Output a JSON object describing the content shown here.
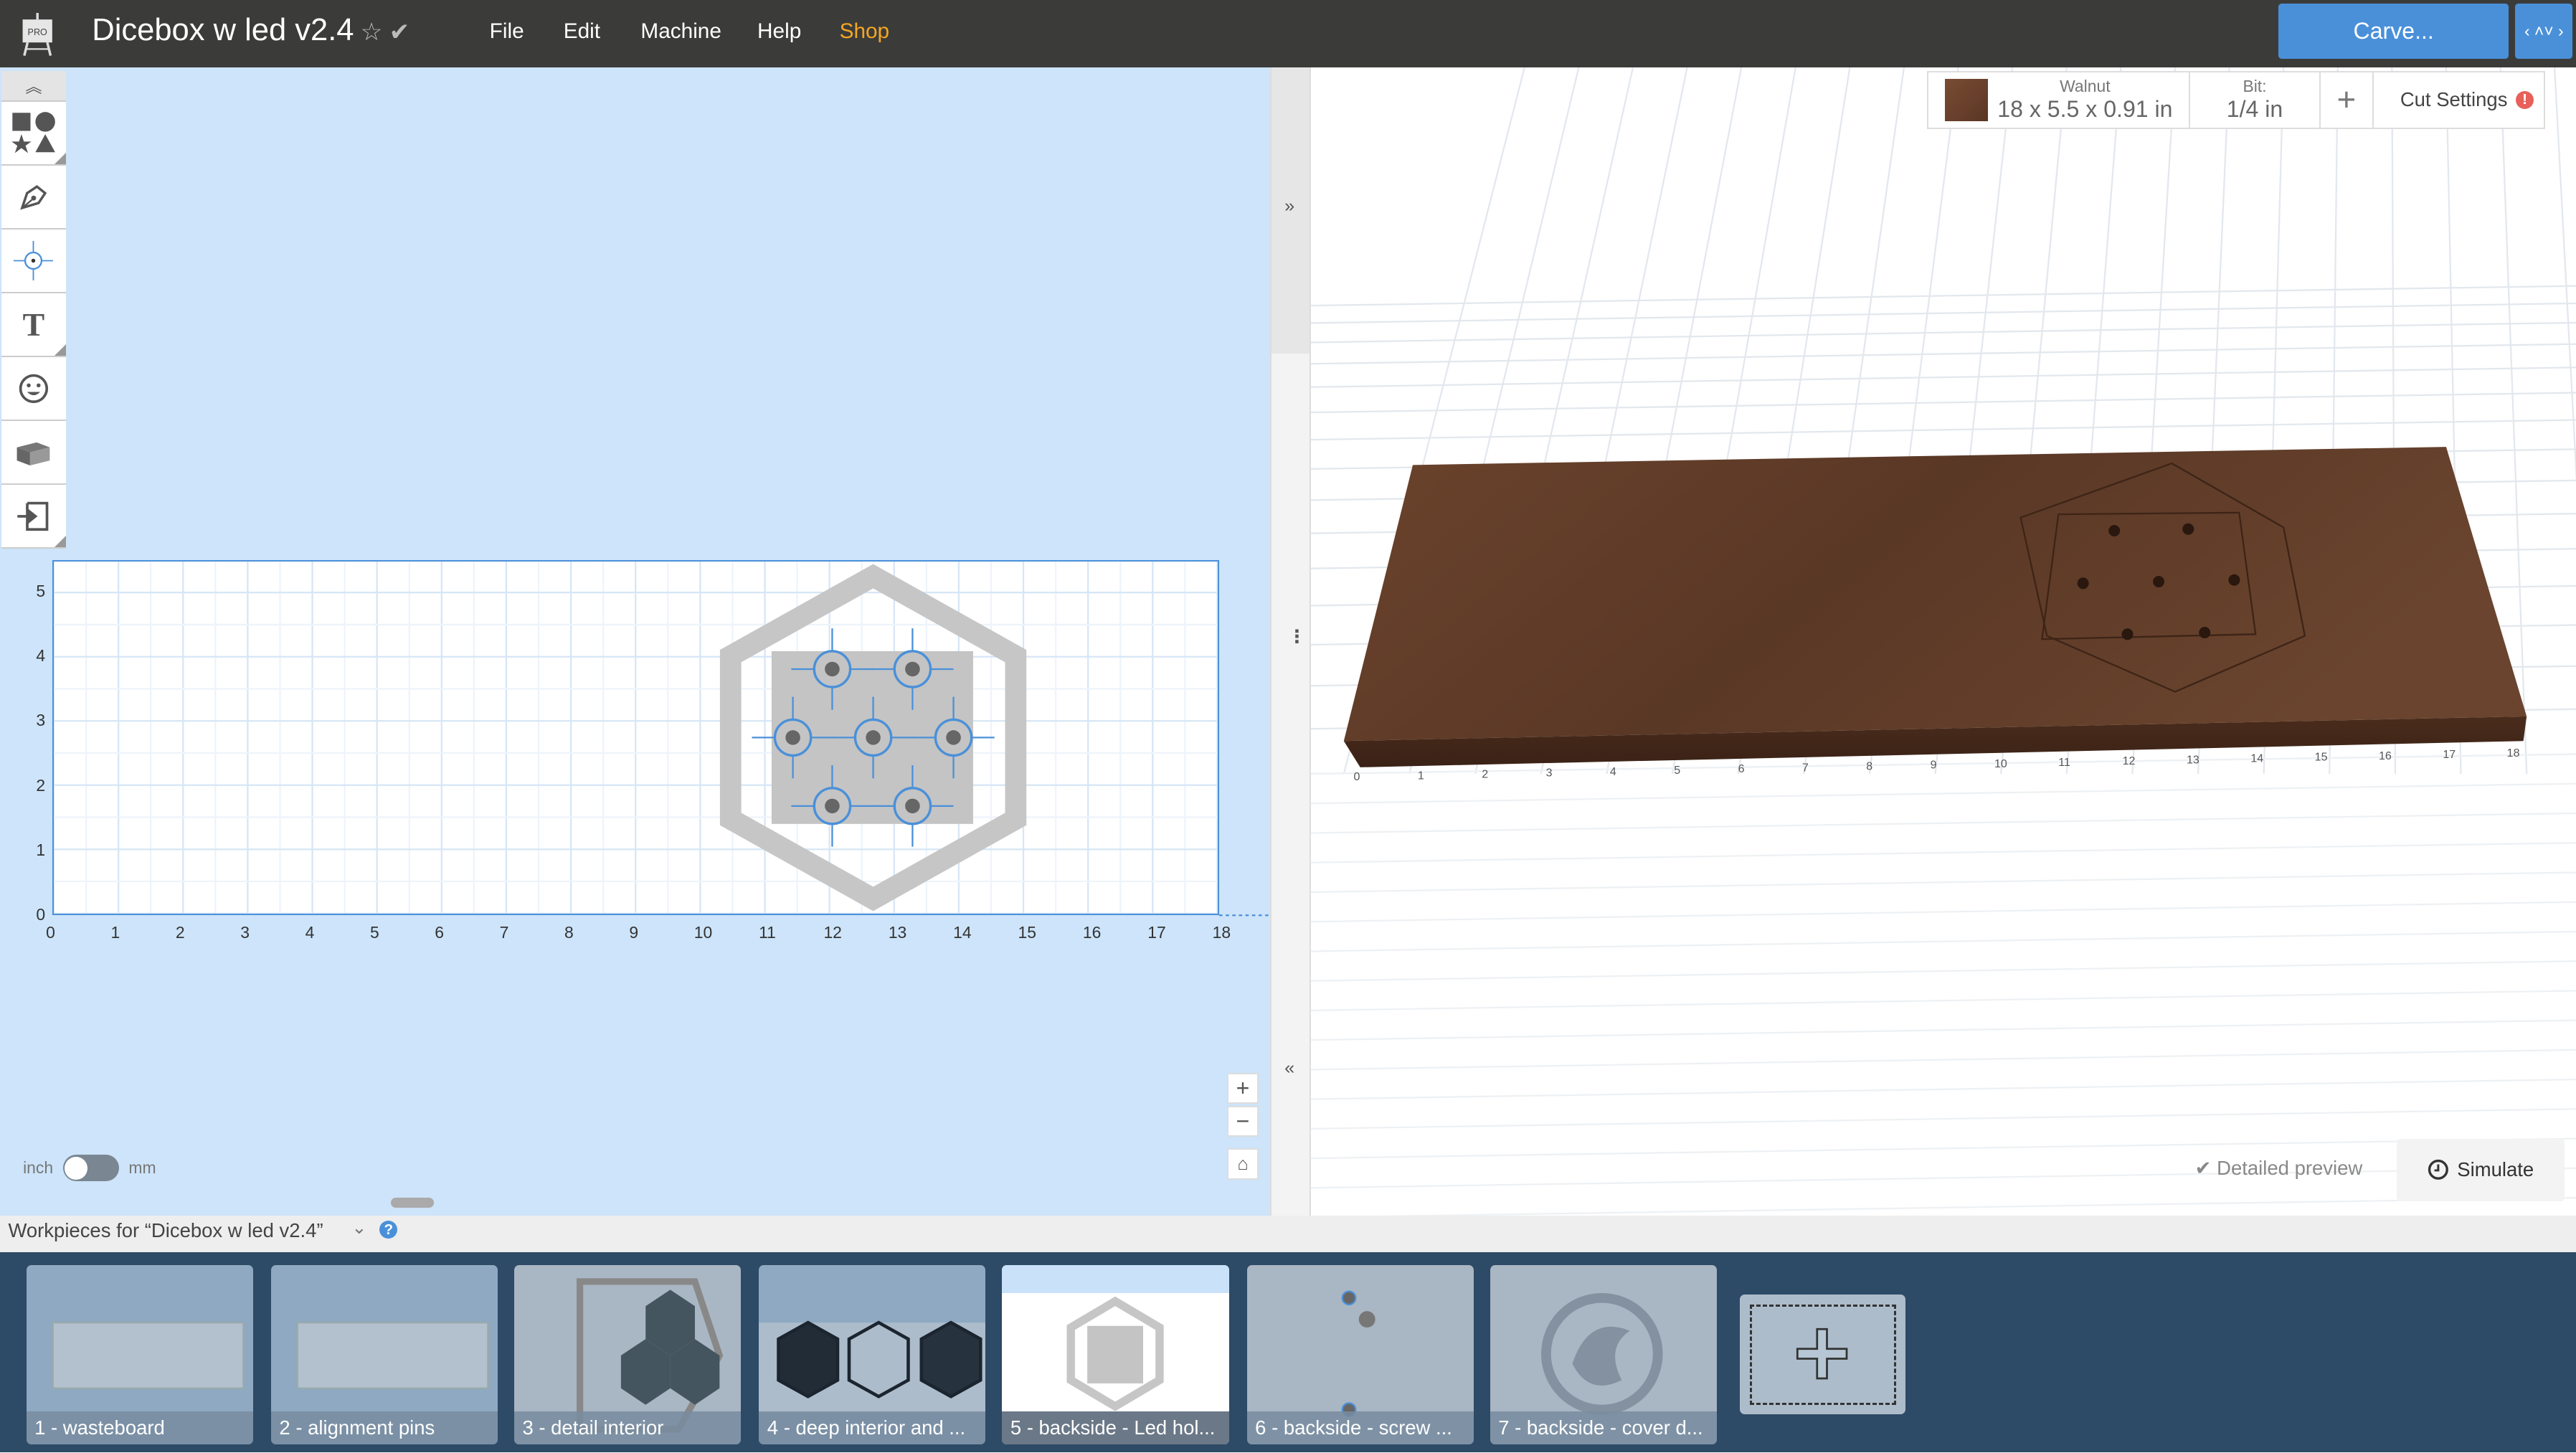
{
  "app": {
    "badge": "PRO",
    "title": "Dicebox w led v2.4",
    "star_icon": "star-icon",
    "saved_icon": "check-icon"
  },
  "menu": [
    "File",
    "Edit",
    "Machine",
    "Help",
    "Shop"
  ],
  "colors": {
    "accent": "#4a90d9",
    "shop": "#f5a623",
    "topbar": "#3b3c3a",
    "workpiece_bar": "#2d4a66",
    "wood": "#5c3a26",
    "warning": "#e8605a"
  },
  "carve_label": "Carve...",
  "tools": [
    "collapse-icon",
    "shapes-icon",
    "pen-icon",
    "point-icon",
    "text-icon",
    "emoji-icon",
    "lego-brick-icon",
    "import-icon"
  ],
  "canvas": {
    "x_ticks": [
      "0",
      "1",
      "2",
      "3",
      "4",
      "5",
      "6",
      "7",
      "8",
      "9",
      "10",
      "11",
      "12",
      "13",
      "14",
      "15",
      "16",
      "17",
      "18"
    ],
    "y_ticks": [
      "0",
      "1",
      "2",
      "3",
      "4",
      "5"
    ]
  },
  "units": {
    "left": "inch",
    "right": "mm",
    "selected": "inch"
  },
  "zoom": {
    "in": "+",
    "out": "−"
  },
  "stock": {
    "material": "Walnut",
    "dimensions": "18 x 5.5 x 0.91 in",
    "bit_label": "Bit:",
    "bit_value": "1/4 in",
    "add": "+",
    "cut_settings": "Cut Settings",
    "warning": "!"
  },
  "preview": {
    "detailed": "Detailed preview",
    "detailed_checked": true,
    "simulate": "Simulate"
  },
  "workpieces": {
    "heading": "Workpieces for “Dicebox w led v2.4”",
    "help": "?",
    "selected_index": 4,
    "items": [
      "1 - wasteboard",
      "2 - alignment pins",
      "3 - detail interior",
      "4 - deep interior and ...",
      "5 - backside - Led hol...",
      "6 - backside - screw ...",
      "7 - backside - cover d..."
    ]
  }
}
